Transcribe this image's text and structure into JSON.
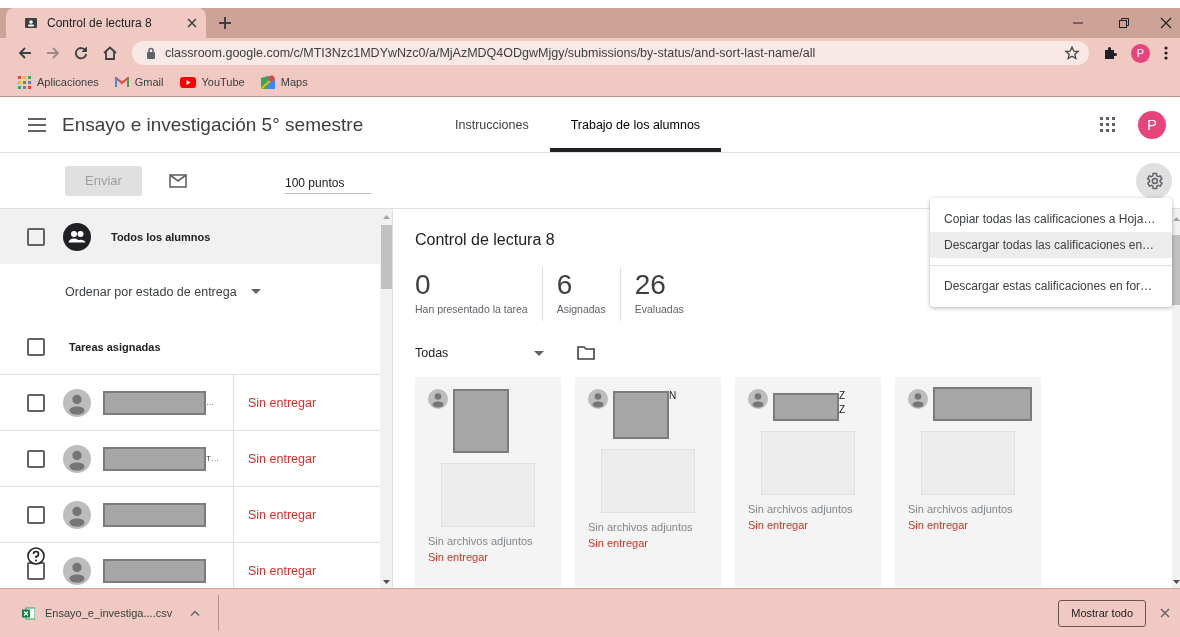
{
  "browser": {
    "tab": {
      "title": "Control de lectura 8"
    },
    "url": "classroom.google.com/c/MTI3Nzc1MDYwNzc0/a/MjAzMDQ4ODgwMjgy/submissions/by-status/and-sort-last-name/all",
    "profile_initial": "P",
    "bookmarks": [
      {
        "label": "Aplicaciones",
        "kind": "apps"
      },
      {
        "label": "Gmail",
        "kind": "mail"
      },
      {
        "label": "YouTube",
        "kind": "video"
      },
      {
        "label": "Maps",
        "kind": "map"
      }
    ]
  },
  "header": {
    "course_title": "Ensayo e investigación 5° semestre",
    "tabs": [
      {
        "label": "Instrucciones",
        "selected": false
      },
      {
        "label": "Trabajo de los alumnos",
        "selected": true
      }
    ],
    "avatar_initial": "P"
  },
  "toolbar": {
    "send_button": {
      "label": "Enviar",
      "disabled": true
    },
    "points": "100 puntos"
  },
  "students_panel": {
    "all_students": {
      "label": "Todos los alumnos",
      "checked": false
    },
    "sort": "Ordenar por estado de entrega",
    "group": {
      "label": "Tareas asignadas",
      "checked": false
    },
    "rows": [
      {
        "name_fragment": "…",
        "status": "Sin entregar",
        "checked": false
      },
      {
        "name_fragment": "T…",
        "status": "Sin entregar",
        "checked": false
      },
      {
        "status": "Sin entregar",
        "checked": false
      },
      {
        "status": "Sin entregar",
        "checked": false
      }
    ]
  },
  "assignment": {
    "title": "Control de lectura 8",
    "stats": [
      {
        "value": "0",
        "label": "Han presentado la tarea"
      },
      {
        "value": "6",
        "label": "Asignadas"
      },
      {
        "value": "26",
        "label": "Evaluadas"
      }
    ],
    "filter": "Todas",
    "cards": [
      {
        "attachment": "Sin archivos adjuntos",
        "status": "Sin entregar"
      },
      {
        "name_fragment": "N",
        "attachment": "Sin archivos adjuntos",
        "status": "Sin entregar"
      },
      {
        "name_fragment": "Z\nZ",
        "attachment": "Sin archivos adjuntos",
        "status": "Sin entregar"
      },
      {
        "attachment": "Sin archivos adjuntos",
        "status": "Sin entregar"
      }
    ]
  },
  "settings_menu": {
    "groups": [
      [
        {
          "label": "Copiar todas las calificaciones a Hoja…",
          "highlighted": false
        },
        {
          "label": "Descargar todas las calificaciones en…",
          "highlighted": true
        }
      ],
      [
        {
          "label": "Descargar estas calificaciones en for…",
          "highlighted": false
        }
      ]
    ]
  },
  "downloads": {
    "file": "Ensayo_e_investiga....csv",
    "show_all": "Mostrar todo"
  }
}
